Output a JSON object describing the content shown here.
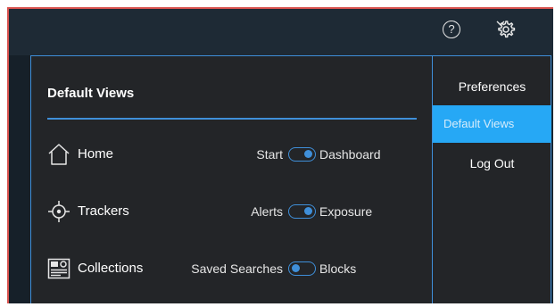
{
  "topbar": {
    "help_icon": "help-icon",
    "help_glyph": "?",
    "settings_icon": "gear-icon",
    "dropdown_icon": "chevron-down-icon"
  },
  "panel": {
    "title": "Default Views",
    "rows": [
      {
        "icon": "home-icon",
        "label": "Home",
        "left_option": "Start",
        "right_option": "Dashboard",
        "toggle_state": "right"
      },
      {
        "icon": "crosshair-icon",
        "label": "Trackers",
        "left_option": "Alerts",
        "right_option": "Exposure",
        "toggle_state": "right"
      },
      {
        "icon": "collections-icon",
        "label": "Collections",
        "left_option": "Saved Searches",
        "right_option": "Blocks",
        "toggle_state": "left"
      }
    ]
  },
  "settings_menu": {
    "items": [
      {
        "label": "Preferences",
        "active": false
      },
      {
        "label": "Default Views",
        "active": true
      },
      {
        "label": "Log Out",
        "active": false
      }
    ]
  },
  "colors": {
    "accent": "#3f8fd9",
    "active_menu": "#26a8f5",
    "panel_bg": "#232528",
    "topbar_bg": "#1e2a35",
    "frame_border": "#d9534f"
  }
}
